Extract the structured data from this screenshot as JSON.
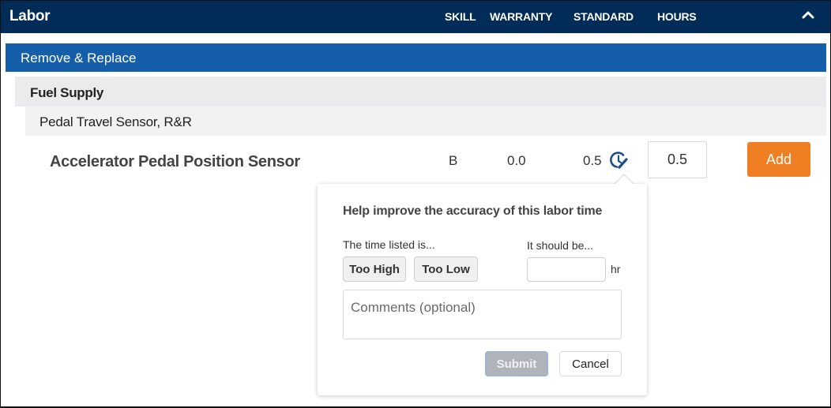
{
  "header": {
    "title": "Labor",
    "columns": {
      "skill": "SKILL",
      "warranty": "WARRANTY",
      "standard": "STANDARD",
      "hours": "HOURS"
    },
    "collapse_icon": "chevron-up-icon"
  },
  "category": {
    "label": "Remove & Replace"
  },
  "group": {
    "label": "Fuel Supply"
  },
  "subgroup": {
    "label": "Pedal Travel Sensor, R&R"
  },
  "operation": {
    "name": "Accelerator Pedal Position Sensor",
    "skill": "B",
    "warranty": "0.0",
    "standard": "0.5",
    "feedback_icon": "clock-edit-icon",
    "hours_value": "0.5",
    "add_label": "Add"
  },
  "feedback": {
    "title": "Help improve the accuracy of this labor time",
    "time_listed_label": "The time listed is...",
    "too_high_label": "Too High",
    "too_low_label": "Too Low",
    "should_be_label": "It should be...",
    "should_be_value": "",
    "unit": "hr",
    "comments_placeholder": "Comments (optional)",
    "submit_label": "Submit",
    "cancel_label": "Cancel"
  },
  "colors": {
    "header_bg": "#022c58",
    "category_bg": "#155ea9",
    "add_button": "#f07e22",
    "submit_disabled": "#b0b4ba"
  }
}
